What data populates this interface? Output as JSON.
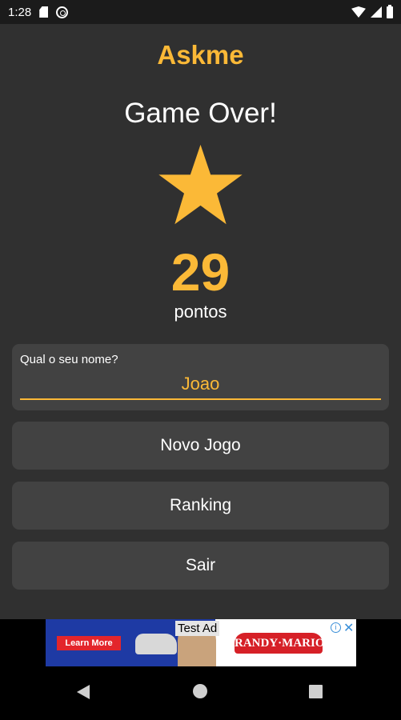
{
  "status_bar": {
    "time": "1:28"
  },
  "app": {
    "title": "Askme",
    "headline": "Game Over!",
    "score": "29",
    "score_unit": "pontos"
  },
  "name_field": {
    "label": "Qual o seu nome?",
    "value": "Joao"
  },
  "buttons": {
    "new_game": "Novo Jogo",
    "ranking": "Ranking",
    "exit": "Sair"
  },
  "ad": {
    "tag": "Test Ad",
    "cta": "Learn More",
    "brand": "RANDY·MARION"
  },
  "colors": {
    "accent": "#fbb937",
    "background": "#303030",
    "surface": "#424242"
  }
}
